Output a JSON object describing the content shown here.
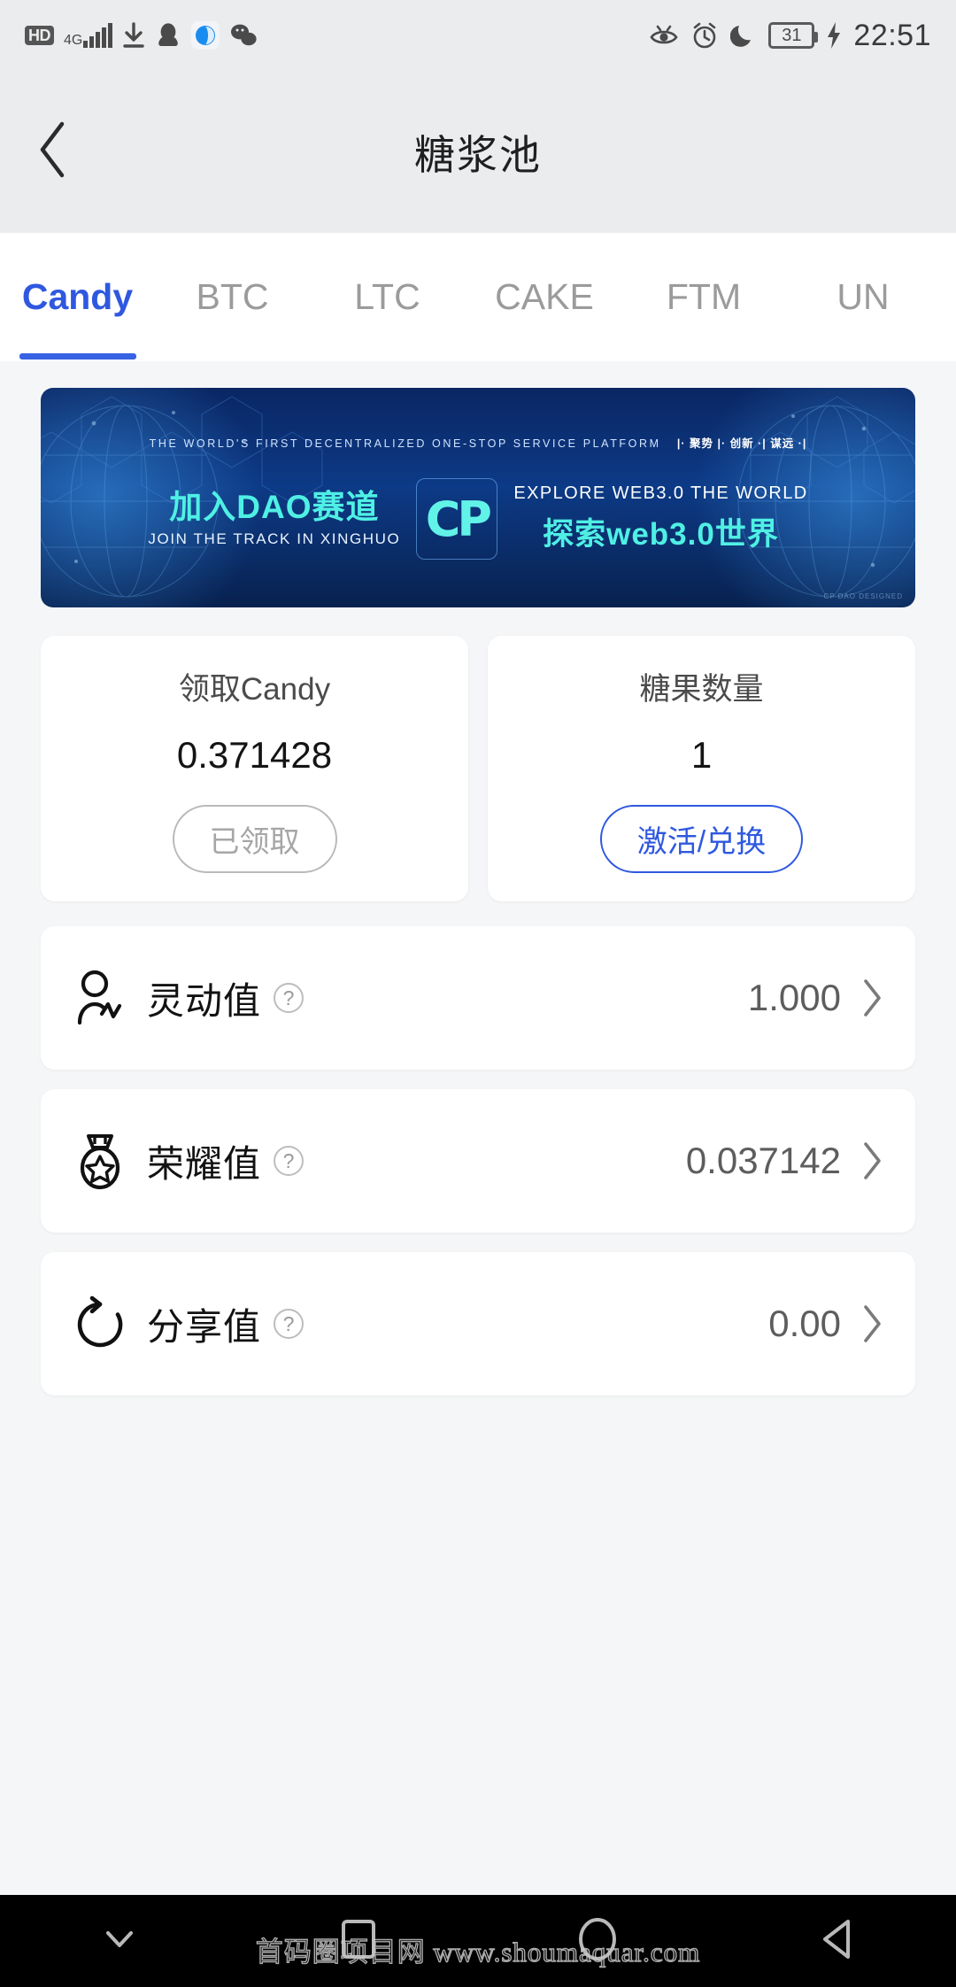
{
  "status_bar": {
    "hd_label": "HD",
    "network": "4G",
    "icons": [
      "hd-icon",
      "signal-4g-icon",
      "download-icon",
      "qq-icon",
      "browser-icon",
      "wechat-icon"
    ],
    "right_icons": [
      "eye-care-icon",
      "alarm-icon",
      "do-not-disturb-icon"
    ],
    "battery_level": "31",
    "charging": true,
    "time": "22:51"
  },
  "header": {
    "back_label": "返回",
    "title": "糖浆池"
  },
  "tabs": {
    "items": [
      {
        "label": "Candy",
        "active": true
      },
      {
        "label": "BTC",
        "active": false
      },
      {
        "label": "LTC",
        "active": false
      },
      {
        "label": "CAKE",
        "active": false
      },
      {
        "label": "FTM",
        "active": false
      },
      {
        "label": "UN",
        "active": false
      }
    ],
    "active_color": "#2f58e0",
    "inactive_color": "#9b9b9b"
  },
  "banner": {
    "tagline_en": "THE WORLD'S FIRST DECENTRALIZED ONE-STOP SERVICE PLATFORM",
    "tagline_cn": "|· 聚势 |· 创新 ·| 谋远 ·|",
    "left_cn": "加入DAO赛道",
    "left_en": "JOIN THE TRACK IN XINGHUO",
    "logo_text": "CP",
    "right_en": "EXPLORE WEB3.0 THE WORLD",
    "right_cn": "探索web3.0世界",
    "credit": "CP DAO DESIGNED",
    "accent_color": "#4ff0e4"
  },
  "stats": {
    "cards": [
      {
        "label": "领取Candy",
        "value": "0.371428",
        "button_label": "已领取",
        "button_style": "disabled"
      },
      {
        "label": "糖果数量",
        "value": "1",
        "button_label": "激活/兑换",
        "button_style": "primary"
      }
    ]
  },
  "list": {
    "items": [
      {
        "icon": "person-pulse-icon",
        "label": "灵动值",
        "help": "?",
        "value": "1.000",
        "chevron": "›"
      },
      {
        "icon": "medal-star-icon",
        "label": "荣耀值",
        "help": "?",
        "value": "0.037142",
        "chevron": "›"
      },
      {
        "icon": "share-refresh-icon",
        "label": "分享值",
        "help": "?",
        "value": "0.00",
        "chevron": "›"
      }
    ]
  },
  "nav_bar": {
    "buttons": [
      {
        "name": "hide-keyboard-button",
        "icon": "chevron-down-icon"
      },
      {
        "name": "recents-button",
        "icon": "square-icon"
      },
      {
        "name": "home-button",
        "icon": "circle-icon"
      },
      {
        "name": "back-button",
        "icon": "triangle-left-icon"
      }
    ]
  },
  "watermark": {
    "text": "首码圈项目网 www.shoumaquar.com"
  }
}
